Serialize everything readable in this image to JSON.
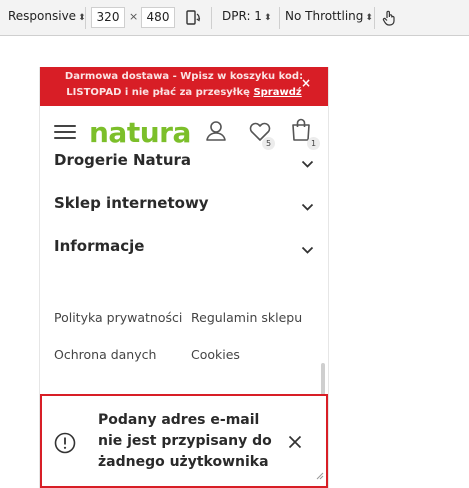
{
  "devtools": {
    "device": "Responsive",
    "width": "320",
    "times": "×",
    "height": "480",
    "dpr": "DPR: 1",
    "throttling": "No Throttling"
  },
  "promo": {
    "line1": "Darmowa dostawa - Wpisz w koszyku kod:",
    "line2_prefix": "LISTOPAD i nie płać za przesyłkę ",
    "link": "Sprawdź",
    "close": "×"
  },
  "header": {
    "logo": "natura",
    "wishlist_count": "5",
    "cart_count": "1"
  },
  "accordion": [
    {
      "label": "Drogerie Natura"
    },
    {
      "label": "Sklep internetowy"
    },
    {
      "label": "Informacje"
    }
  ],
  "links": {
    "privacy": "Polityka prywatności",
    "terms": "Regulamin sklepu",
    "data": "Ochrona danych",
    "cookies": "Cookies"
  },
  "toast": {
    "message": "Podany adres e-mail nie jest przypisany do żadnego użytkownika"
  },
  "colors": {
    "brand_red": "#d81e26",
    "brand_green": "#7cbf2a"
  }
}
